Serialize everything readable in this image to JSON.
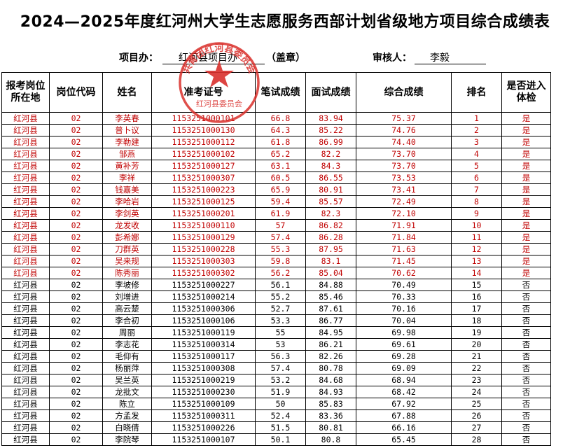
{
  "title": "2024—2025年度红河州大学生志愿服务西部计划省级地方项目综合成绩表",
  "header": {
    "office_label": "项目办：",
    "office_value": "红河县项目办",
    "seal_note": "（盖章）",
    "reviewer_label": "审核人：",
    "reviewer_value": "李毅"
  },
  "stamp": {
    "top_text": "共青团红河县委员会",
    "bottom_text": "红河县委员会",
    "color": "#d9302c"
  },
  "columns": [
    "报考岗位所在地",
    "岗位代码",
    "姓名",
    "准考证号",
    "笔试成绩",
    "面试成绩",
    "综合成绩",
    "排名",
    "是否进入体检"
  ],
  "rows": [
    {
      "loc": "红河县",
      "code": "02",
      "name": "李英春",
      "id": "1153251000101",
      "written": "66.8",
      "interview": "83.94",
      "total": "75.37",
      "rank": "1",
      "pass": "是"
    },
    {
      "loc": "红河县",
      "code": "02",
      "name": "普卜议",
      "id": "1153251000130",
      "written": "64.3",
      "interview": "85.22",
      "total": "74.76",
      "rank": "2",
      "pass": "是"
    },
    {
      "loc": "红河县",
      "code": "02",
      "name": "李勒建",
      "id": "1153251000112",
      "written": "61.8",
      "interview": "86.99",
      "total": "74.40",
      "rank": "3",
      "pass": "是"
    },
    {
      "loc": "红河县",
      "code": "02",
      "name": "邹燕",
      "id": "1153251000102",
      "written": "65.2",
      "interview": "82.2",
      "total": "73.70",
      "rank": "4",
      "pass": "是"
    },
    {
      "loc": "红河县",
      "code": "02",
      "name": "黄补芳",
      "id": "1153251000127",
      "written": "63.1",
      "interview": "84.3",
      "total": "73.70",
      "rank": "5",
      "pass": "是"
    },
    {
      "loc": "红河县",
      "code": "02",
      "name": "李祥",
      "id": "1153251000307",
      "written": "60.5",
      "interview": "86.55",
      "total": "73.53",
      "rank": "6",
      "pass": "是"
    },
    {
      "loc": "红河县",
      "code": "02",
      "name": "钱嘉美",
      "id": "1153251000223",
      "written": "65.9",
      "interview": "80.91",
      "total": "73.41",
      "rank": "7",
      "pass": "是"
    },
    {
      "loc": "红河县",
      "code": "02",
      "name": "李哈岩",
      "id": "1153251000125",
      "written": "59.4",
      "interview": "85.57",
      "total": "72.49",
      "rank": "8",
      "pass": "是"
    },
    {
      "loc": "红河县",
      "code": "02",
      "name": "李剑英",
      "id": "1153251000201",
      "written": "61.9",
      "interview": "82.3",
      "total": "72.10",
      "rank": "9",
      "pass": "是"
    },
    {
      "loc": "红河县",
      "code": "02",
      "name": "龙发收",
      "id": "1153251000110",
      "written": "57",
      "interview": "86.82",
      "total": "71.91",
      "rank": "10",
      "pass": "是"
    },
    {
      "loc": "红河县",
      "code": "02",
      "name": "彭希娜",
      "id": "1153251000129",
      "written": "57.4",
      "interview": "86.28",
      "total": "71.84",
      "rank": "11",
      "pass": "是"
    },
    {
      "loc": "红河县",
      "code": "02",
      "name": "刀群英",
      "id": "1153251000228",
      "written": "55.3",
      "interview": "87.95",
      "total": "71.63",
      "rank": "12",
      "pass": "是"
    },
    {
      "loc": "红河县",
      "code": "02",
      "name": "吴来规",
      "id": "1153251000303",
      "written": "59.8",
      "interview": "83.1",
      "total": "71.45",
      "rank": "13",
      "pass": "是"
    },
    {
      "loc": "红河县",
      "code": "02",
      "name": "陈秀丽",
      "id": "1153251000302",
      "written": "56.2",
      "interview": "85.04",
      "total": "70.62",
      "rank": "14",
      "pass": "是"
    },
    {
      "loc": "红河县",
      "code": "02",
      "name": "李坡修",
      "id": "1153251000227",
      "written": "56.1",
      "interview": "84.88",
      "total": "70.49",
      "rank": "15",
      "pass": "否"
    },
    {
      "loc": "红河县",
      "code": "02",
      "name": "刘增进",
      "id": "1153251000214",
      "written": "55.2",
      "interview": "85.46",
      "total": "70.33",
      "rank": "16",
      "pass": "否"
    },
    {
      "loc": "红河县",
      "code": "02",
      "name": "高云楚",
      "id": "1153251000306",
      "written": "52.7",
      "interview": "87.61",
      "total": "70.16",
      "rank": "17",
      "pass": "否"
    },
    {
      "loc": "红河县",
      "code": "02",
      "name": "李合初",
      "id": "1153251000106",
      "written": "53.3",
      "interview": "86.77",
      "total": "70.04",
      "rank": "18",
      "pass": "否"
    },
    {
      "loc": "红河县",
      "code": "02",
      "name": "周丽",
      "id": "1153251000119",
      "written": "55",
      "interview": "84.95",
      "total": "69.98",
      "rank": "19",
      "pass": "否"
    },
    {
      "loc": "红河县",
      "code": "02",
      "name": "李志花",
      "id": "1153251000314",
      "written": "53",
      "interview": "86.21",
      "total": "69.61",
      "rank": "20",
      "pass": "否"
    },
    {
      "loc": "红河县",
      "code": "02",
      "name": "毛仰有",
      "id": "1153251000117",
      "written": "56.3",
      "interview": "82.26",
      "total": "69.28",
      "rank": "21",
      "pass": "否"
    },
    {
      "loc": "红河县",
      "code": "02",
      "name": "杨丽萍",
      "id": "1153251000308",
      "written": "57.4",
      "interview": "80.78",
      "total": "69.09",
      "rank": "22",
      "pass": "否"
    },
    {
      "loc": "红河县",
      "code": "02",
      "name": "吴兰英",
      "id": "1153251000219",
      "written": "53.2",
      "interview": "84.68",
      "total": "68.94",
      "rank": "23",
      "pass": "否"
    },
    {
      "loc": "红河县",
      "code": "02",
      "name": "龙批文",
      "id": "1153251000230",
      "written": "51.9",
      "interview": "84.93",
      "total": "68.42",
      "rank": "24",
      "pass": "否"
    },
    {
      "loc": "红河县",
      "code": "02",
      "name": "陈立",
      "id": "1153251000109",
      "written": "50",
      "interview": "85.83",
      "total": "67.92",
      "rank": "25",
      "pass": "否"
    },
    {
      "loc": "红河县",
      "code": "02",
      "name": "方孟发",
      "id": "1153251000311",
      "written": "52.4",
      "interview": "83.36",
      "total": "67.88",
      "rank": "26",
      "pass": "否"
    },
    {
      "loc": "红河县",
      "code": "02",
      "name": "白晓倩",
      "id": "1153251000226",
      "written": "51.5",
      "interview": "80.81",
      "total": "66.16",
      "rank": "27",
      "pass": "否"
    },
    {
      "loc": "红河县",
      "code": "02",
      "name": "李院琴",
      "id": "1153251000107",
      "written": "50.1",
      "interview": "80.8",
      "total": "65.45",
      "rank": "28",
      "pass": "否"
    }
  ]
}
